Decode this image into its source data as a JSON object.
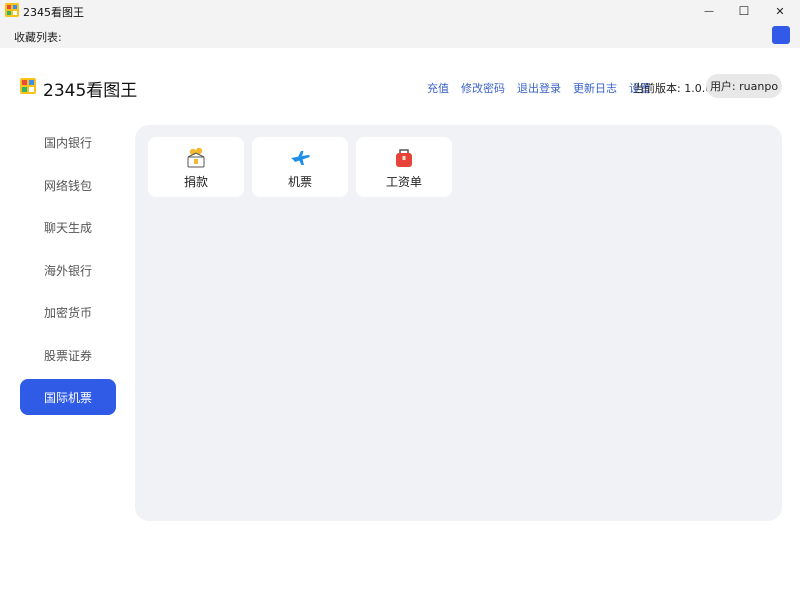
{
  "window": {
    "title": "2345看图王",
    "minimize_glyph": "—",
    "maximize_glyph": "☐",
    "close_glyph": "✕"
  },
  "favorites_bar": {
    "label": "收藏列表:"
  },
  "header": {
    "app_name": "2345看图王",
    "links": [
      "充值",
      "修改密码",
      "退出登录",
      "更新日志",
      "设置"
    ],
    "version": "当前版本: 1.0.0",
    "user": "用户: ruanpo"
  },
  "sidebar": {
    "items": [
      {
        "label": "国内银行",
        "active": false
      },
      {
        "label": "网络钱包",
        "active": false
      },
      {
        "label": "聊天生成",
        "active": false
      },
      {
        "label": "海外银行",
        "active": false
      },
      {
        "label": "加密货币",
        "active": false
      },
      {
        "label": "股票证券",
        "active": false
      },
      {
        "label": "国际机票",
        "active": true
      }
    ]
  },
  "cards": [
    {
      "label": "捐款",
      "icon": "donation-box-icon"
    },
    {
      "label": "机票",
      "icon": "airplane-icon"
    },
    {
      "label": "工资单",
      "icon": "payroll-bag-icon"
    }
  ],
  "colors": {
    "accent": "#2f5be7",
    "link": "#3a63c8",
    "panel_bg": "#f1f2f6",
    "favorites_square": "#3259e8"
  }
}
